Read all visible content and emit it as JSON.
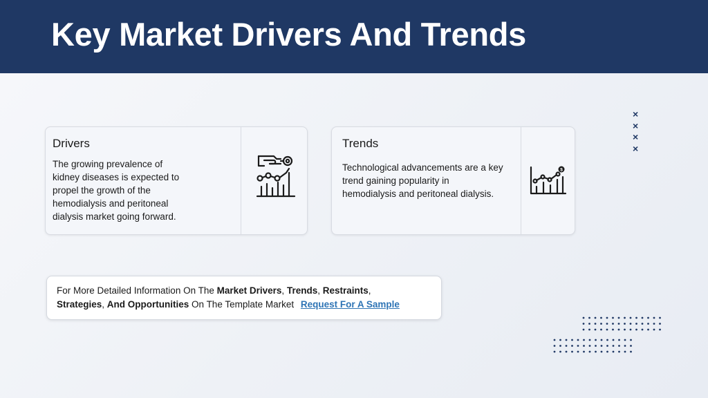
{
  "header": {
    "title": "Key Market Drivers And Trends"
  },
  "drivers": {
    "heading": "Drivers",
    "lines": [
      "The growing prevalence of",
      "kidney diseases is expected to",
      "propel the growth of the",
      "hemodialysis and peritoneal",
      "dialysis market going forward."
    ],
    "icon": "analytics-icon"
  },
  "trends": {
    "heading": "Trends",
    "lines": [
      "Technological advancements are a key",
      "trend gaining popularity in",
      "hemodialysis and peritoneal dialysis."
    ],
    "icon": "growth-chart-icon"
  },
  "decor": {
    "xmark": "×"
  },
  "info": {
    "t1": "For More Detailed Information On The ",
    "b1": "Market Drivers",
    "t2": ", ",
    "b2": "Trends",
    "t3": ", ",
    "b3": "Restraints",
    "t4": ",",
    "b4": "Strategies",
    "t5": ", ",
    "b5": "And Opportunities",
    "t6": " On The Template Market ",
    "link": "Request For A Sample"
  },
  "colors": {
    "header": "#1f3864",
    "link": "#2e74b5"
  }
}
